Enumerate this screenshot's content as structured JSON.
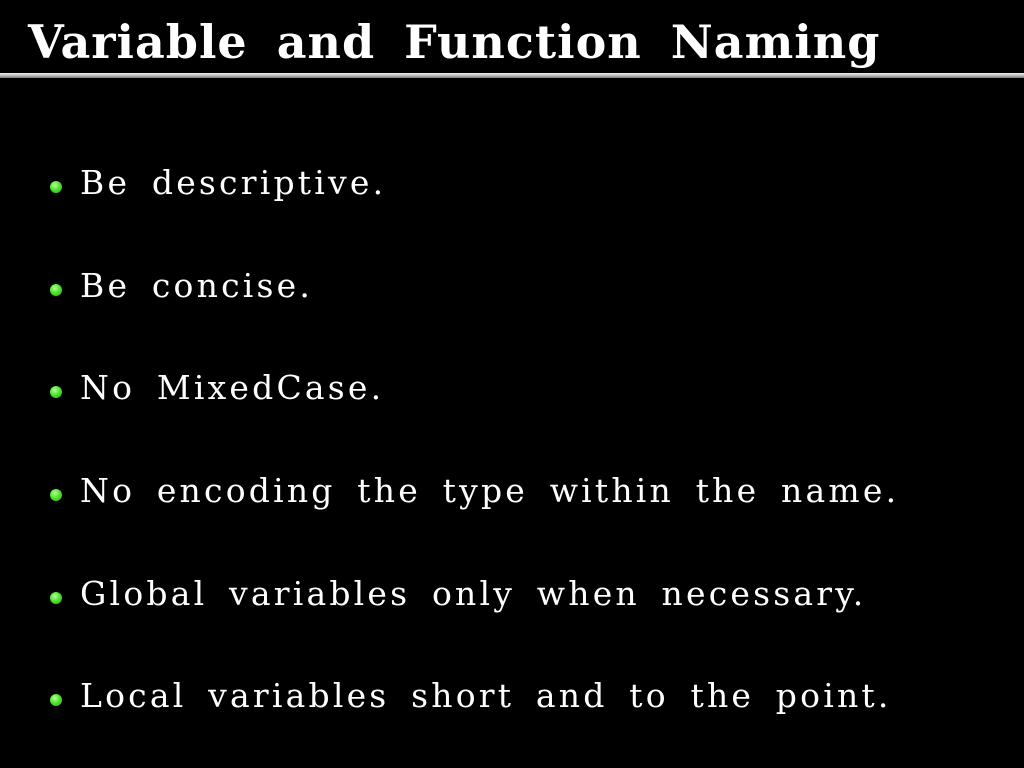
{
  "slide": {
    "title": "Variable and Function Naming",
    "bullets": [
      {
        "icon": "bullet-dot-icon",
        "text": "Be descriptive."
      },
      {
        "icon": "bullet-dot-icon",
        "text": "Be concise."
      },
      {
        "icon": "bullet-dot-icon",
        "text": "No MixedCase."
      },
      {
        "icon": "bullet-dot-icon",
        "text": "No encoding the type within the name."
      },
      {
        "icon": "bullet-dot-icon",
        "text": "Global variables only when necessary."
      },
      {
        "icon": "bullet-dot-icon",
        "text": "Local variables short and to the point."
      }
    ]
  },
  "colors": {
    "background": "#000000",
    "text": "#ffffff",
    "bullet": "#4fe52d",
    "rule": "#bdbdbd"
  }
}
